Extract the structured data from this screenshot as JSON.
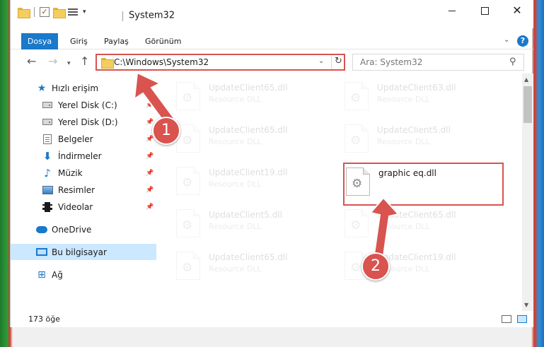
{
  "window": {
    "title": "System32"
  },
  "qat": {
    "dropdown_glyph": "▾"
  },
  "window_controls": {
    "minimize": "—",
    "maximize": "☐",
    "close": "✕"
  },
  "ribbon": {
    "tabs": [
      {
        "label": "Dosya",
        "active": true
      },
      {
        "label": "Giriş"
      },
      {
        "label": "Paylaş"
      },
      {
        "label": "Görünüm"
      }
    ],
    "expand_glyph": "⌄",
    "help_glyph": "?"
  },
  "nav": {
    "back_glyph": "←",
    "forward_glyph": "→",
    "recent_glyph": "▾",
    "up_glyph": "↑",
    "address": "C:\\Windows\\System32",
    "address_dropdown": "⌄",
    "refresh_glyph": "↻",
    "search_placeholder": "Ara: System32",
    "search_glyph": "⚲"
  },
  "sidebar": {
    "items": [
      {
        "label": "Hızlı erişim",
        "icon": "star-icon"
      },
      {
        "label": "Yerel Disk (C:)",
        "icon": "drive-icon",
        "pinned": true
      },
      {
        "label": "Yerel Disk (D:)",
        "icon": "drive-icon",
        "pinned": true
      },
      {
        "label": "Belgeler",
        "icon": "document-icon",
        "pinned": true
      },
      {
        "label": "İndirmeler",
        "icon": "download-icon",
        "pinned": true
      },
      {
        "label": "Müzik",
        "icon": "music-icon",
        "pinned": true
      },
      {
        "label": "Resimler",
        "icon": "pictures-icon",
        "pinned": true
      },
      {
        "label": "Videolar",
        "icon": "videos-icon",
        "pinned": true
      },
      {
        "label": "OneDrive",
        "icon": "onedrive-icon"
      },
      {
        "label": "Bu bilgisayar",
        "icon": "this-pc-icon",
        "selected": true
      },
      {
        "label": "Ağ",
        "icon": "network-icon"
      }
    ],
    "pin_glyph": "📌"
  },
  "files": [
    {
      "name": "UpdateClient65.dll",
      "type": "Resource DLL",
      "dimmed": true
    },
    {
      "name": "UpdateClient63.dll",
      "type": "Resource DLL",
      "dimmed": true
    },
    {
      "name": "UpdateClient65.dll",
      "type": "Resource DLL",
      "dimmed": true
    },
    {
      "name": "UpdateClient5.dll",
      "type": "Resource DLL",
      "dimmed": true
    },
    {
      "name": "UpdateClient19.dll",
      "type": "Resource DLL",
      "dimmed": true
    },
    {
      "name": "graphic eq.dll",
      "type": "",
      "dimmed": false,
      "highlighted": true
    },
    {
      "name": "UpdateClient5.dll",
      "type": "Resource DLL",
      "dimmed": true
    },
    {
      "name": "UpdateClient65.dll",
      "type": "Resource DLL",
      "dimmed": true
    },
    {
      "name": "UpdateClient65.dll",
      "type": "Resource DLL",
      "dimmed": true
    },
    {
      "name": "UpdateClient19.dll",
      "type": "Resource DLL",
      "dimmed": true
    }
  ],
  "file_icon_glyph": "⚙",
  "scrollbar": {
    "up_glyph": "▲",
    "down_glyph": "▼"
  },
  "status": {
    "item_count": "173 öğe"
  },
  "annotations": {
    "callout_1": "1",
    "callout_2": "2",
    "color": "#d9534f"
  },
  "colors": {
    "accent": "#1979ca",
    "selected_bg": "#cce8ff",
    "annotation_red": "#d9534f"
  }
}
